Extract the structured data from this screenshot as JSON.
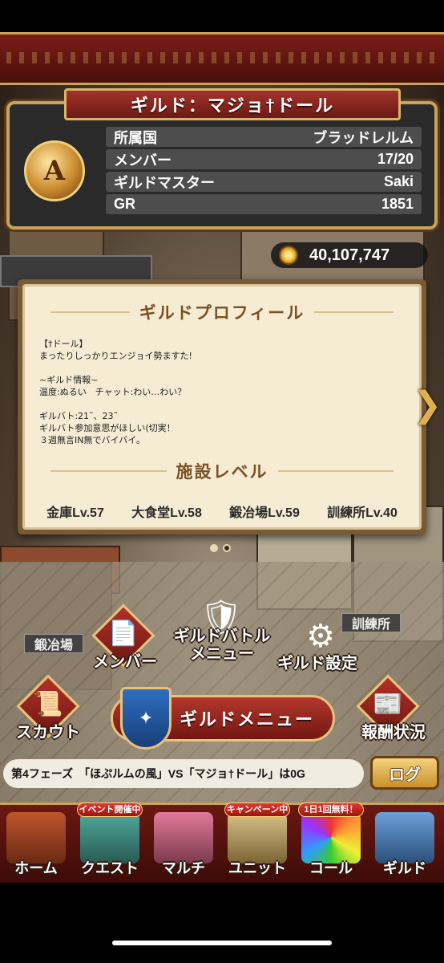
{
  "guild": {
    "title": "ギルド：マジョ†ドール",
    "emblem_letter": "A",
    "info": [
      {
        "label": "所属国",
        "value": "ブラッドレルム"
      },
      {
        "label": "メンバー",
        "value": "17/20"
      },
      {
        "label": "ギルドマスター",
        "value": "Saki"
      },
      {
        "label": "GR",
        "value": "1851"
      }
    ]
  },
  "gold": {
    "amount": "40,107,747",
    "icon": "gold-coin-icon"
  },
  "profile": {
    "heading": "ギルドプロフィール",
    "text": "【†ドール】\nまったりしっかりエンジョイ勢ますた!\n\n~ギルド情報~\n温度:ぬるい　チャット:わい…わい？\n\nギルバト:21˜、23˜\nギルバト参加意思がほしい(切実！\n３週無言IN無でバイバイ。",
    "facility_heading": "施設レベル",
    "facilities": [
      "金庫Lv.57",
      "大食堂Lv.58",
      "鍛冶場Lv.59",
      "訓練所Lv.40"
    ]
  },
  "building_labels": {
    "smithy": "鍛冶場",
    "training": "訓練所"
  },
  "menus": {
    "member": "メンバー",
    "guild_battle": "ギルドバトル\nメニュー",
    "guild_settings": "ギルド設定",
    "scout": "スカウト",
    "guild_menu": "ギルドメニュー",
    "rewards": "報酬状況"
  },
  "ticker": {
    "text": "第4フェーズ　「ほぷルムの風」VS「マジョ†ドール」は0G",
    "log_button": "ログ"
  },
  "nav": {
    "home": {
      "label": "ホーム"
    },
    "quest": {
      "label": "クエスト",
      "badge": "イベント開催中"
    },
    "multi": {
      "label": "マルチ"
    },
    "unit": {
      "label": "ユニット",
      "badge": "キャンペーン中"
    },
    "call": {
      "label": "コール",
      "badge": "1日1回無料！"
    },
    "guild": {
      "label": "ギルド"
    }
  }
}
